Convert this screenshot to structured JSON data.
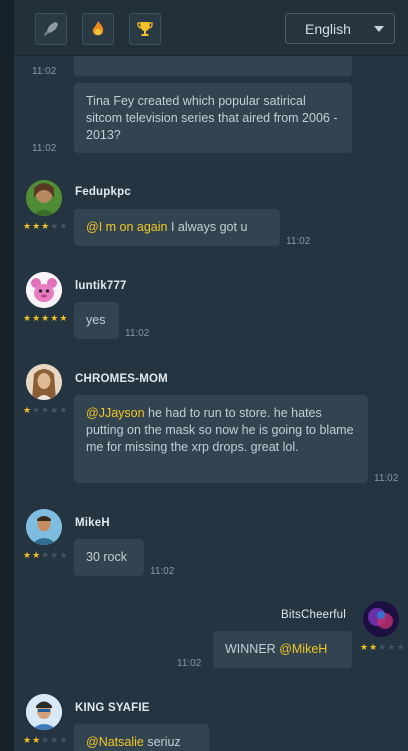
{
  "topbar": {
    "icons": [
      "rocket-icon",
      "fire-badge-icon",
      "trophy-icon"
    ],
    "language": "English"
  },
  "colors": {
    "mention": "#f3c524",
    "star_on": "#f2c127",
    "star_off": "#45545f",
    "bubble": "#32444f"
  },
  "messages": [
    {
      "id": "m0",
      "text_partial": "...",
      "time": "11:02"
    },
    {
      "id": "m1",
      "text": "Tina Fey created which popular satirical sitcom television series that aired from 2006 - 2013?",
      "time": "11:02"
    },
    {
      "id": "m2",
      "user": "Fedupkpc",
      "stars": 3,
      "mention": "@I m on again",
      "text": "I always got u",
      "time": "11:02"
    },
    {
      "id": "m3",
      "user": "luntik777",
      "stars": 5,
      "text": "yes",
      "time": "11:02"
    },
    {
      "id": "m4",
      "user": "CHROMES-MOM",
      "stars": 1,
      "mention": "@JJayson",
      "text": "he had to run to store. he hates putting on the mask so now he is going to blame me for missing the xrp drops. great lol.",
      "time": "11:02"
    },
    {
      "id": "m5",
      "user": "MikeH",
      "stars": 2,
      "text": "30 rock",
      "time": "11:02"
    },
    {
      "id": "m6",
      "user": "BitsCheerful",
      "stars": 2,
      "text": "WINNER",
      "mention": "@MikeH",
      "time": "11:02"
    },
    {
      "id": "m7",
      "user": "KING SYAFIE",
      "stars": 2,
      "mention": "@Natsalie",
      "text": "seriuz"
    }
  ]
}
